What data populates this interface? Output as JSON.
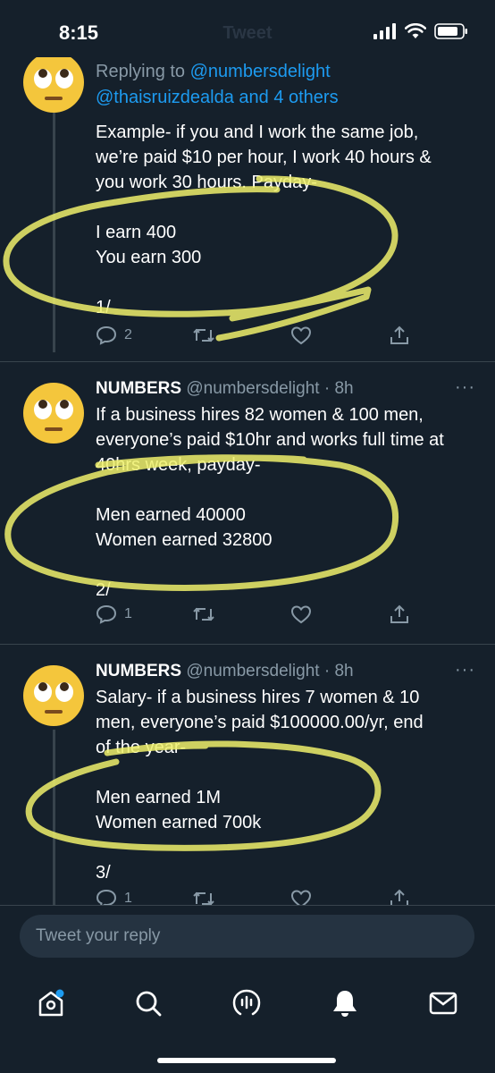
{
  "status_bar": {
    "time": "8:15",
    "screen_title": "Tweet"
  },
  "thread": [
    {
      "reply_prefix": "Replying to",
      "reply_to_primary": "@numbersdelight",
      "reply_to_secondary": "@thaisruizdealda and 4 others",
      "lines": [
        "Example- if you and I work the same job,",
        "we’re paid $10 per hour, I work 40 hours &",
        "you work 30 hours. Payday-",
        "",
        "I earn 400",
        "You earn 300",
        "",
        "1/"
      ],
      "reply_count": "2"
    },
    {
      "name": "NUMBERS",
      "handle": "@numbersdelight",
      "dot": "·",
      "time": "8h",
      "lines": [
        "If a business hires 82 women & 100 men,",
        "everyone’s paid $10hr and works full time at",
        "40hrs week, payday-",
        "",
        "Men earned 40000",
        "Women earned 32800",
        "",
        "2/"
      ],
      "reply_count": "1"
    },
    {
      "name": "NUMBERS",
      "handle": "@numbersdelight",
      "dot": "·",
      "time": "8h",
      "lines": [
        "Salary- if a business hires 7 women & 10",
        "men, everyone’s paid $100000.00/yr, end",
        "of the year-",
        "",
        "Men earned 1M",
        "Women earned 700k",
        "",
        "3/"
      ],
      "reply_count": "1"
    }
  ],
  "more_label": "···",
  "reply_box": {
    "placeholder": "Tweet your reply"
  },
  "tab_bar": {
    "items": [
      "home-icon",
      "search-icon",
      "spaces-icon",
      "notifications-icon",
      "messages-icon"
    ],
    "home_badge": true
  },
  "colors": {
    "background": "#15202b",
    "accent": "#1d9bf0",
    "muted": "#8899a6",
    "highlight": "#eef06b"
  }
}
